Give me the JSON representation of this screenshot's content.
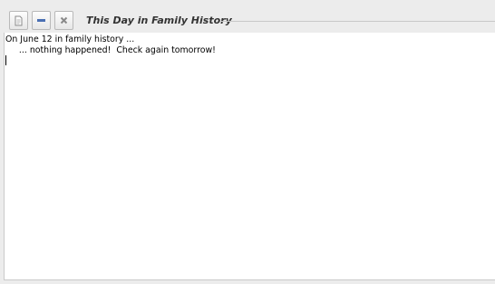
{
  "window": {
    "title": "This Day in Family History",
    "buttons": {
      "detach_icon": "page-icon",
      "minimize_icon": "minus-icon",
      "close_icon": "x-icon"
    },
    "colors": {
      "minimize": "#4a6fb3",
      "close": "#8a8a8a"
    }
  },
  "content": {
    "line1": "On June 12 in family history ...",
    "line2": "     ... nothing happened!  Check again tomorrow!"
  }
}
